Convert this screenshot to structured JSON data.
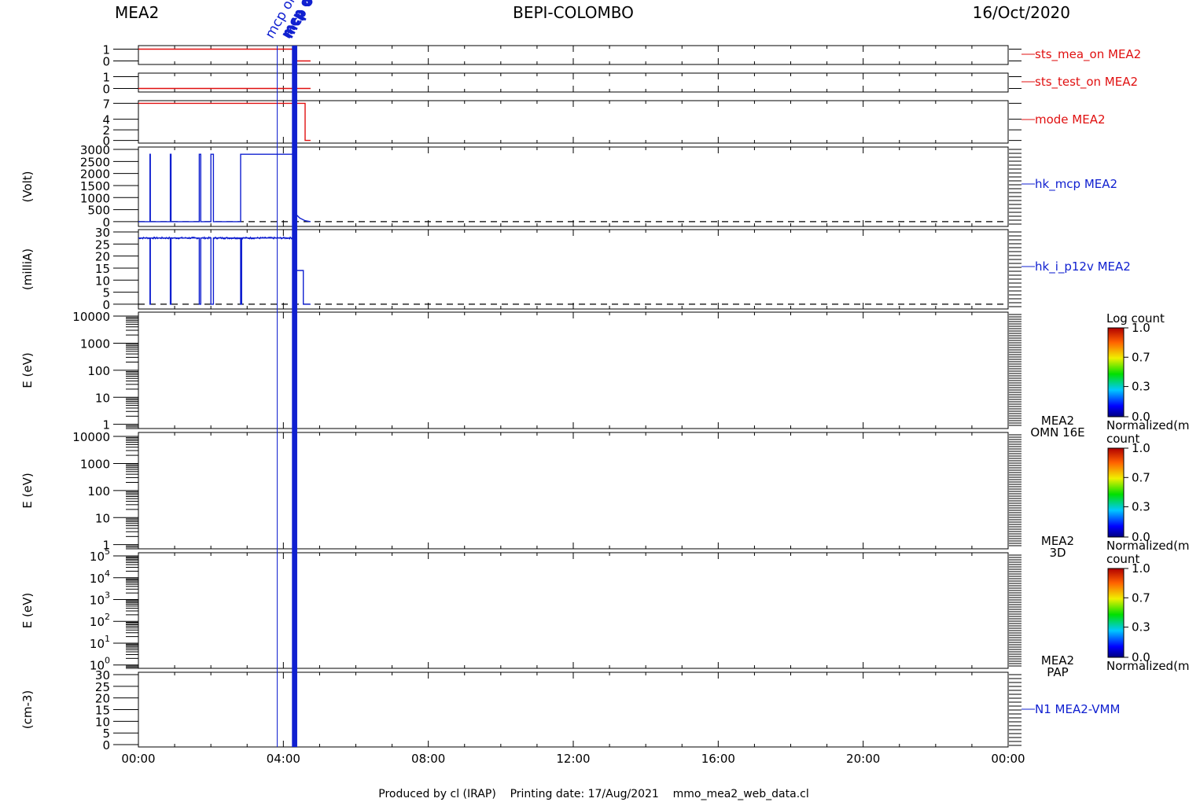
{
  "header": {
    "left": "MEA2",
    "center": "BEPI-COLOMBO",
    "right": "16/Oct/2020"
  },
  "footer": "Produced by cl (IRAP)    Printing date: 17/Aug/2021    mmo_mea2_web_data.cl",
  "colors": {
    "red": "#e01010",
    "blue": "#1020d0",
    "black": "#000000"
  },
  "chart_data": {
    "type": "line",
    "x_axis": {
      "unit": "hours",
      "range": [
        0,
        24
      ],
      "ticks": [
        {
          "value": 0,
          "label": "00:00"
        },
        {
          "value": 4,
          "label": "04:00"
        },
        {
          "value": 8,
          "label": "08:00"
        },
        {
          "value": 12,
          "label": "12:00"
        },
        {
          "value": 16,
          "label": "16:00"
        },
        {
          "value": 20,
          "label": "20:00"
        },
        {
          "value": 24,
          "label": "00:00"
        }
      ]
    },
    "markers": [
      {
        "time": 3.83,
        "label": "mcp on",
        "weight": "thin"
      },
      {
        "time": 4.27,
        "label": "mcp off",
        "weight": "thick"
      },
      {
        "time": 4.3,
        "label": "mcp off",
        "weight": "thick"
      },
      {
        "time": 4.35,
        "label": "mcp off",
        "weight": "thick"
      }
    ],
    "panels": [
      {
        "id": "sts_mea_on",
        "label": "sts_mea_on  MEA2",
        "ylabel": "",
        "color": "red",
        "ylim": [
          -0.3,
          1.3
        ],
        "yticks": [
          {
            "value": 0,
            "label": "0"
          },
          {
            "value": 1,
            "label": "1"
          }
        ],
        "series": [
          {
            "x": [
              0,
              4.28,
              4.28,
              4.75
            ],
            "y": [
              1,
              1,
              0,
              0
            ]
          }
        ]
      },
      {
        "id": "sts_test_on",
        "label": "sts_test_on  MEA2",
        "ylabel": "",
        "color": "red",
        "ylim": [
          -0.3,
          1.3
        ],
        "yticks": [
          {
            "value": 0,
            "label": "0"
          },
          {
            "value": 1,
            "label": "1"
          }
        ],
        "series": [
          {
            "x": [
              0,
              4.28,
              4.28,
              4.75
            ],
            "y": [
              0,
              0,
              0,
              0
            ]
          }
        ]
      },
      {
        "id": "mode",
        "label": "mode  MEA2",
        "ylabel": "",
        "color": "red",
        "ylim": [
          -0.5,
          7.5
        ],
        "yticks": [
          {
            "value": 0,
            "label": "0"
          },
          {
            "value": 2,
            "label": "2"
          },
          {
            "value": 4,
            "label": "4"
          },
          {
            "value": 7,
            "label": "7"
          }
        ],
        "series": [
          {
            "x": [
              0,
              4.6,
              4.6,
              4.75
            ],
            "y": [
              7,
              7,
              0,
              0
            ]
          }
        ]
      },
      {
        "id": "hk_mcp",
        "label": "hk_mcp  MEA2",
        "ylabel": "(Volt)",
        "color": "blue",
        "ylim": [
          -200,
          3100
        ],
        "yticks": [
          {
            "value": 0,
            "label": "0"
          },
          {
            "value": 500,
            "label": "500"
          },
          {
            "value": 1000,
            "label": "1000"
          },
          {
            "value": 1500,
            "label": "1500"
          },
          {
            "value": 2000,
            "label": "2000"
          },
          {
            "value": 2500,
            "label": "2500"
          },
          {
            "value": 3000,
            "label": "3000"
          }
        ],
        "baseline": 0,
        "series": [
          {
            "x": [
              0,
              0.32,
              0.32,
              0.33,
              0.33,
              0.88,
              0.88,
              0.9,
              0.9,
              1.68,
              1.68,
              1.72,
              1.72,
              2.0,
              2.0,
              2.07,
              2.07,
              2.82,
              2.82,
              2.85,
              2.85,
              4.28,
              4.28,
              4.35,
              4.45,
              4.6,
              4.75
            ],
            "y": [
              0,
              0,
              2800,
              2800,
              0,
              0,
              2800,
              2800,
              0,
              0,
              2800,
              2800,
              0,
              0,
              2800,
              2800,
              0,
              0,
              2800,
              2800,
              2800,
              2800,
              0,
              300,
              150,
              40,
              0
            ]
          }
        ]
      },
      {
        "id": "hk_i_p12v",
        "label": "hk_i_p12v  MEA2",
        "ylabel": "(milliA)",
        "color": "blue",
        "ylim": [
          -2,
          31
        ],
        "yticks": [
          {
            "value": 0,
            "label": "0"
          },
          {
            "value": 5,
            "label": "5"
          },
          {
            "value": 10,
            "label": "10"
          },
          {
            "value": 15,
            "label": "15"
          },
          {
            "value": 20,
            "label": "20"
          },
          {
            "value": 25,
            "label": "25"
          },
          {
            "value": 30,
            "label": "30"
          }
        ],
        "baseline": 0,
        "noise": 0.4,
        "series": [
          {
            "x": [
              0,
              0.32,
              0.32,
              0.33,
              0.33,
              0.88,
              0.88,
              0.9,
              0.9,
              1.68,
              1.68,
              1.72,
              1.72,
              2.0,
              2.0,
              2.07,
              2.07,
              2.82,
              2.82,
              2.85,
              2.85,
              4.28,
              4.28,
              4.55,
              4.55,
              4.6,
              4.6,
              4.75
            ],
            "y": [
              27.5,
              27.5,
              0,
              0,
              27.5,
              27.5,
              0,
              0,
              27.5,
              27.5,
              0,
              0,
              27.5,
              27.5,
              0,
              0,
              27.5,
              27.5,
              0,
              0,
              27.5,
              27.5,
              14,
              14,
              0,
              0,
              0,
              0
            ]
          }
        ]
      },
      {
        "id": "omni_16e",
        "label_lines": [
          "MEA2",
          "OMN 16E"
        ],
        "ylabel": "E (eV)",
        "scale": "log",
        "ylim": [
          0.7,
          14000
        ],
        "yticks": [
          {
            "value": 1,
            "label": "1"
          },
          {
            "value": 10,
            "label": "10"
          },
          {
            "value": 100,
            "label": "100"
          },
          {
            "value": 1000,
            "label": "1000"
          },
          {
            "value": 10000,
            "label": "10000"
          }
        ],
        "colorbar": {
          "title": "Log count",
          "subtitle": "Normalized(m",
          "ticks": [
            "1.0",
            "0.7",
            "0.3",
            "0.0"
          ]
        }
      },
      {
        "id": "3d",
        "label_lines": [
          "MEA2",
          "3D"
        ],
        "ylabel": "E (eV)",
        "scale": "log",
        "ylim": [
          0.7,
          14000
        ],
        "yticks": [
          {
            "value": 1,
            "label": "1"
          },
          {
            "value": 10,
            "label": "10"
          },
          {
            "value": 100,
            "label": "100"
          },
          {
            "value": 1000,
            "label": "1000"
          },
          {
            "value": 10000,
            "label": "10000"
          }
        ],
        "colorbar": {
          "title": "count",
          "subtitle": "Normalized(m",
          "ticks": [
            "1.0",
            "0.7",
            "0.3",
            "0.0"
          ]
        }
      },
      {
        "id": "pap",
        "label_lines": [
          "MEA2",
          "PAP"
        ],
        "ylabel": "E (eV)",
        "scale": "log",
        "ylim": [
          0.7,
          140000
        ],
        "yticks": [
          {
            "value": 1,
            "label": "10",
            "sup": "0"
          },
          {
            "value": 10,
            "label": "10",
            "sup": "1"
          },
          {
            "value": 100,
            "label": "10",
            "sup": "2"
          },
          {
            "value": 1000,
            "label": "10",
            "sup": "3"
          },
          {
            "value": 10000,
            "label": "10",
            "sup": "4"
          },
          {
            "value": 100000,
            "label": "10",
            "sup": "5"
          }
        ],
        "colorbar": {
          "title": "count",
          "subtitle": "Normalized(m",
          "ticks": [
            "1.0",
            "0.7",
            "0.3",
            "0.0"
          ]
        }
      },
      {
        "id": "n1",
        "label": "N1  MEA2-VMM",
        "ylabel": "(cm-3)",
        "color": "blue",
        "ylim": [
          -1,
          31
        ],
        "yticks": [
          {
            "value": 0,
            "label": "0"
          },
          {
            "value": 5,
            "label": "5"
          },
          {
            "value": 10,
            "label": "10"
          },
          {
            "value": 15,
            "label": "15"
          },
          {
            "value": 20,
            "label": "20"
          },
          {
            "value": 25,
            "label": "25"
          },
          {
            "value": 30,
            "label": "30"
          }
        ],
        "series": []
      }
    ]
  }
}
